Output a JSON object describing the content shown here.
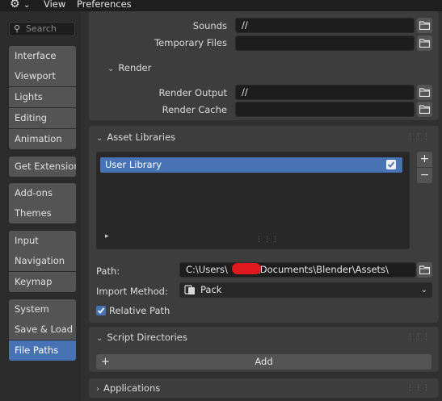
{
  "topbar": {
    "gear_glyph": "⚙",
    "gear_chevron": "⌄",
    "menu_view": "View",
    "menu_preferences": "Preferences"
  },
  "sidebar": {
    "search_placeholder": "Search",
    "groups": [
      [
        "Interface",
        "Viewport",
        "Lights",
        "Editing",
        "Animation"
      ],
      [
        "Get Extensions"
      ],
      [
        "Add-ons",
        "Themes"
      ],
      [
        "Input",
        "Navigation",
        "Keymap"
      ],
      [
        "System",
        "Save & Load",
        "File Paths"
      ]
    ],
    "active_item": "File Paths"
  },
  "paths_panel": {
    "sounds_label": "Sounds",
    "sounds_value": "//",
    "temp_label": "Temporary Files",
    "temp_value": "",
    "render_subheader": "Render",
    "render_output_label": "Render Output",
    "render_output_value": "//",
    "render_cache_label": "Render Cache",
    "render_cache_value": ""
  },
  "asset_libraries": {
    "header": "Asset Libraries",
    "libraries": [
      {
        "name": "User Library",
        "enabled": true
      }
    ],
    "add_glyph": "+",
    "remove_glyph": "−",
    "expand_glyph": "▸",
    "path_label": "Path:",
    "path_prefix": "C:\\Users\\",
    "path_suffix": "\\Documents\\Blender\\Assets\\",
    "import_method_label": "Import Method:",
    "import_method_value": "Pack",
    "relative_path_label": "Relative Path",
    "relative_path_checked": true
  },
  "script_directories": {
    "header": "Script Directories",
    "add_label": "Add",
    "add_glyph": "+"
  },
  "applications": {
    "header": "Applications"
  },
  "colors": {
    "accent": "#4772b3",
    "panel": "#3d3d3d",
    "field": "#1d1d1d",
    "redaction": "#e0191e"
  }
}
